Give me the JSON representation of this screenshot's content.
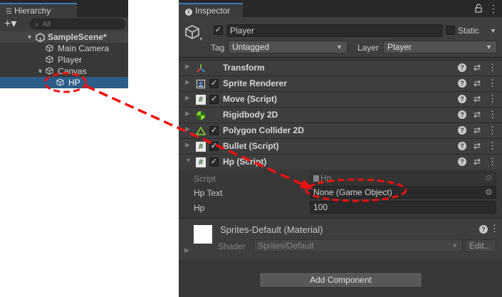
{
  "hierarchy": {
    "tab_label": "Hierarchy",
    "tab_icon": "list-icon",
    "add_button_label": "+▾",
    "search_placeholder": "All",
    "scene_name": "SampleScene*",
    "items": [
      {
        "label": "Main Camera"
      },
      {
        "label": "Player"
      },
      {
        "label": "Canvas"
      },
      {
        "label": "HP"
      }
    ]
  },
  "inspector": {
    "tab_label": "Inspector",
    "tab_icon": "info-icon",
    "lock_glyph": "🔒",
    "menu_glyph": "⋮",
    "object": {
      "name": "Player",
      "static_label": "Static",
      "tag_label": "Tag",
      "tag_value": "Untagged",
      "layer_label": "Layer",
      "layer_value": "Player"
    },
    "components": [
      {
        "name": "Transform",
        "icon": "transform-icon",
        "has_checkbox": false
      },
      {
        "name": "Sprite Renderer",
        "icon": "sprite-renderer-icon",
        "has_checkbox": true
      },
      {
        "name": "Move (Script)",
        "icon": "script-icon",
        "has_checkbox": true
      },
      {
        "name": "Rigidbody 2D",
        "icon": "rigidbody-icon",
        "has_checkbox": false
      },
      {
        "name": "Polygon Collider 2D",
        "icon": "polygon-collider-icon",
        "has_checkbox": true
      },
      {
        "name": "Bullet (Script)",
        "icon": "script-icon",
        "has_checkbox": true
      },
      {
        "name": "Hp (Script)",
        "icon": "script-icon",
        "has_checkbox": true
      }
    ],
    "hp_script": {
      "script_label": "Script",
      "script_value": "Hp",
      "hp_text_label": "Hp Text",
      "hp_text_value": "None (Game Object)",
      "hp_label": "Hp",
      "hp_value": "100"
    },
    "material": {
      "name": "Sprites-Default (Material)",
      "shader_label": "Shader",
      "shader_value": "Sprites/Default",
      "edit_button": "Edit..."
    },
    "add_component_label": "Add Component"
  },
  "annotation": {
    "color": "#ee1111"
  }
}
